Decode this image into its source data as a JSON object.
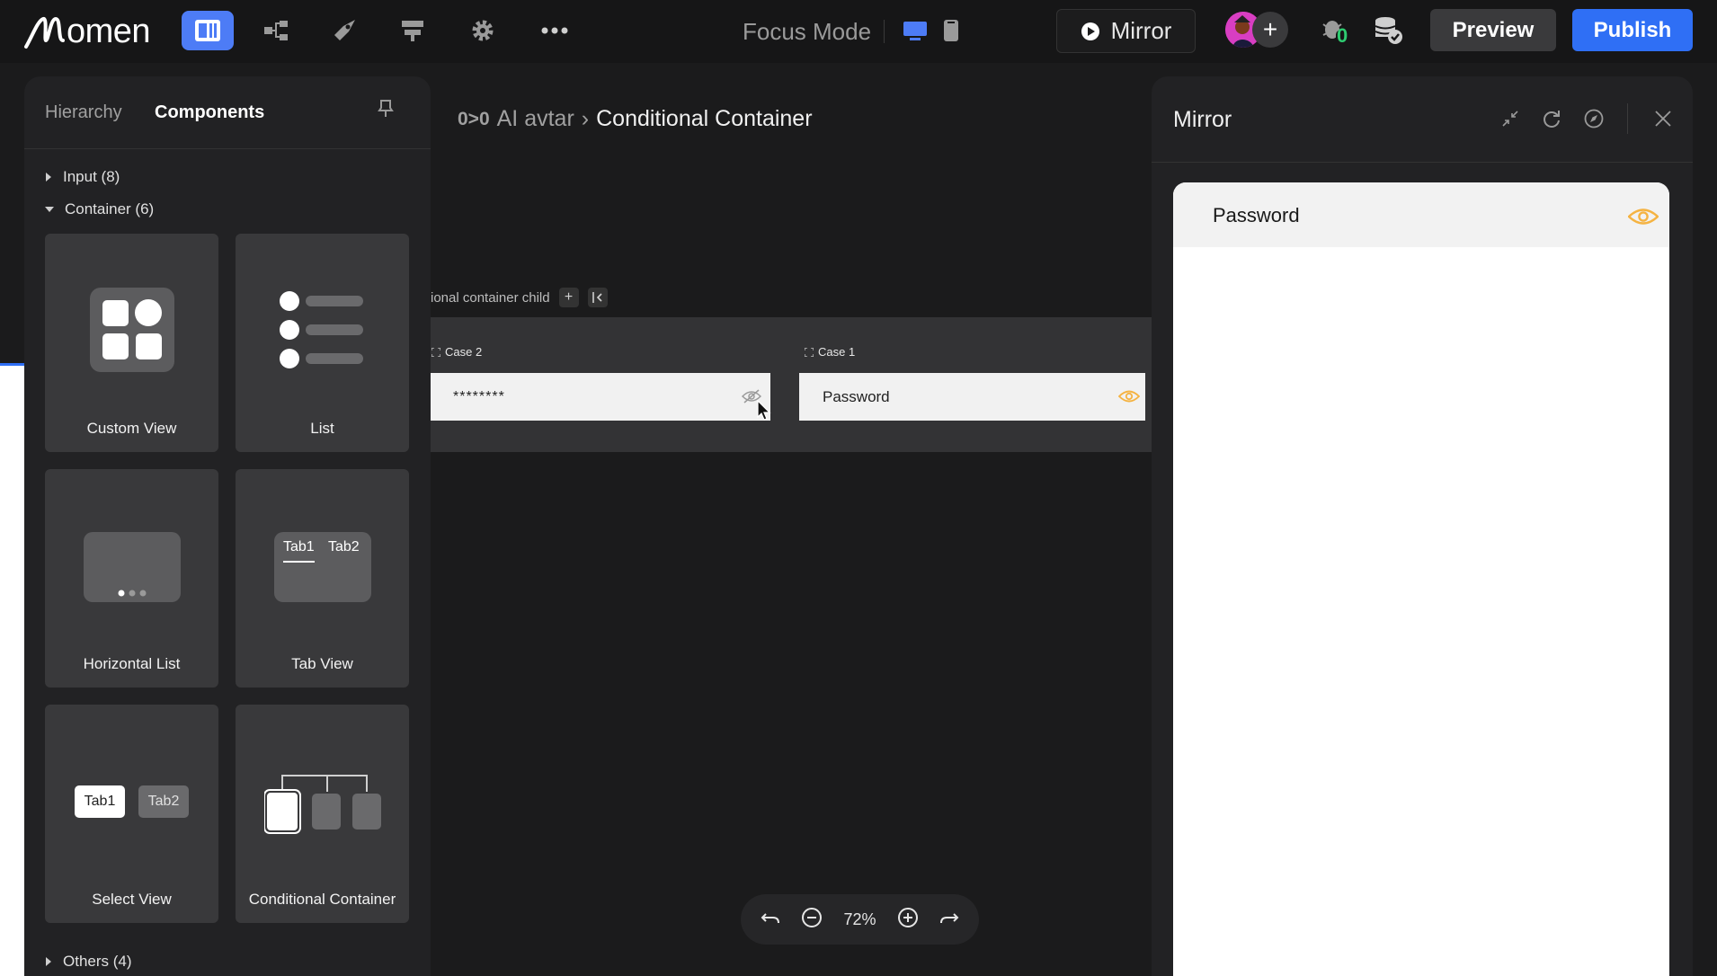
{
  "topbar": {
    "logo_text": "omen",
    "focus_mode_label": "Focus Mode",
    "mirror_label": "Mirror",
    "preview_label": "Preview",
    "publish_label": "Publish",
    "debug_badge": "0",
    "icons": [
      "logo-icon",
      "components-icon",
      "hierarchy-tree-icon",
      "rocket-icon",
      "layout-icon",
      "gear-icon",
      "more-icon",
      "desktop-icon",
      "mobile-icon",
      "play-icon",
      "avatar",
      "add-collaborator-icon",
      "bug-icon",
      "database-check-icon"
    ],
    "accent": "#2f6ff5"
  },
  "left_panel": {
    "tab_hierarchy": "Hierarchy",
    "tab_components": "Components",
    "categories": {
      "input": "Input (8)",
      "container": "Container (6)",
      "others": "Others (4)"
    },
    "components": [
      {
        "label": "Custom View"
      },
      {
        "label": "List"
      },
      {
        "label": "Horizontal List"
      },
      {
        "label": "Tab View",
        "tab1": "Tab1",
        "tab2": "Tab2"
      },
      {
        "label": "Select View",
        "tab1": "Tab1",
        "tab2": "Tab2"
      },
      {
        "label": "Conditional Container"
      }
    ]
  },
  "canvas": {
    "breadcrumb": {
      "icon": "0>0",
      "parent": "AI avtar",
      "separator": "›",
      "current": "Conditional Container"
    },
    "container_toolbar_label": "ional container child",
    "cases": [
      {
        "label": "Case 2",
        "value": "********",
        "icon": "eye-slash-icon"
      },
      {
        "label": "Case 1",
        "value": "Password",
        "icon": "eye-icon"
      }
    ],
    "zoom": "72%"
  },
  "mirror": {
    "title": "Mirror",
    "password_label": "Password",
    "eye_color": "#f5b342"
  }
}
